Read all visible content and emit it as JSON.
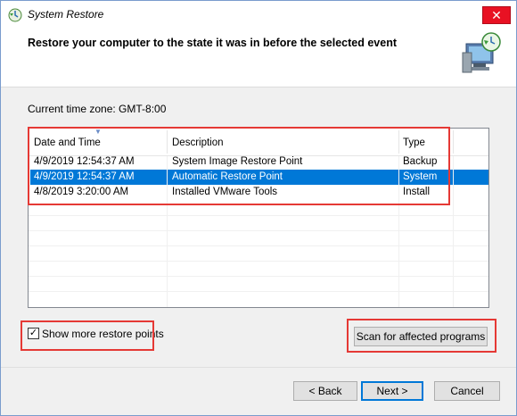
{
  "window": {
    "title": "System Restore",
    "close_glyph": "✕"
  },
  "header": {
    "title": "Restore your computer to the state it was in before the selected event"
  },
  "timezone": "Current time zone: GMT-8:00",
  "table": {
    "columns": [
      "Date and Time",
      "Description",
      "Type"
    ],
    "rows": [
      {
        "date": "4/9/2019 12:54:37 AM",
        "description": "System Image Restore Point",
        "type": "Backup",
        "selected": false
      },
      {
        "date": "4/9/2019 12:54:37 AM",
        "description": "Automatic Restore Point",
        "type": "System",
        "selected": true
      },
      {
        "date": "4/8/2019 3:20:00 AM",
        "description": "Installed VMware Tools",
        "type": "Install",
        "selected": false
      }
    ]
  },
  "options": {
    "show_more_label": "Show more restore points",
    "show_more_checked": true,
    "check_glyph": "✓"
  },
  "buttons": {
    "scan": "Scan for affected programs",
    "back": "< Back",
    "next": "Next >",
    "cancel": "Cancel"
  },
  "colors": {
    "selection": "#0078d7",
    "highlight": "#e53935",
    "close": "#e81123"
  }
}
